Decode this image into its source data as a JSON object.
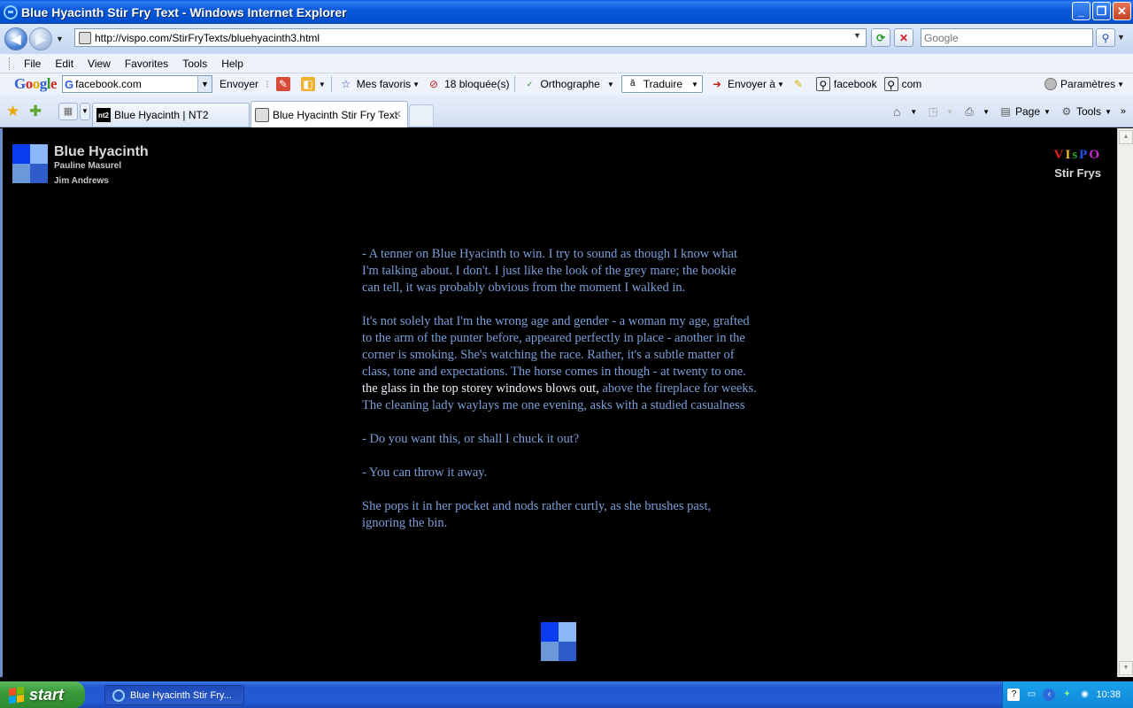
{
  "window": {
    "title": "Blue Hyacinth Stir Fry Text - Windows Internet Explorer",
    "minimize": "_",
    "maximize": "❐",
    "close": "✕"
  },
  "address": {
    "url": "http://vispo.com/StirFryTexts/bluehyacinth3.html",
    "search_placeholder": "Google"
  },
  "menu": {
    "items": [
      "File",
      "Edit",
      "View",
      "Favorites",
      "Tools",
      "Help"
    ]
  },
  "google_toolbar": {
    "search_value": "facebook.com",
    "send": "Envoyer",
    "favorites": "Mes favoris",
    "blocked": "18 bloquée(s)",
    "spell": "Orthographe",
    "translate": "Traduire",
    "send_to": "Envoyer à",
    "facebook": "facebook",
    "com": "com",
    "settings": "Paramètres"
  },
  "tabs": [
    {
      "label": "Blue Hyacinth | NT2",
      "active": false
    },
    {
      "label": "Blue Hyacinth Stir Fry Text",
      "active": true
    }
  ],
  "command_bar": {
    "page": "Page",
    "tools": "Tools"
  },
  "page": {
    "title": "Blue Hyacinth",
    "author1": "Pauline Masurel",
    "author2": "Jim Andrews",
    "vispo_letters": [
      "V",
      "I",
      "s",
      "P",
      "O"
    ],
    "stirfrys": "Stir Frys",
    "paragraphs": [
      "- A tenner on Blue Hyacinth to win. I try to sound as though I know what I'm talking about. I don't. I just like the look of the grey mare; the bookie can tell, it was probably obvious from the moment I walked in.",
      "It's not solely that I'm the wrong age and gender - a woman my age, grafted to the arm of the punter before, appeared perfectly in place - another in the corner is smoking. She's watching the race. Rather, it's a subtle matter of class, tone and expectations. The horse comes in though - at twenty to one.",
      "- Do you want this, or shall I chuck it out?",
      "- You can throw it away.",
      "She pops it in her pocket and nods rather curtly, as she brushes past, ignoring the bin."
    ],
    "p2_highlight": "the glass in the top storey windows blows out,",
    "p2_after": "above the fireplace for weeks. The cleaning lady waylays me one evening, asks with a studied casualness"
  },
  "taskbar": {
    "start": "start",
    "task": "Blue Hyacinth Stir Fry...",
    "clock": "10:38"
  },
  "colors": {
    "sq1": "#0a3cf0",
    "sq2": "#8ab8f8",
    "sq3": "#6a98d8",
    "sq4": "#2e5cc8",
    "story_text": "#7a9ed8"
  }
}
